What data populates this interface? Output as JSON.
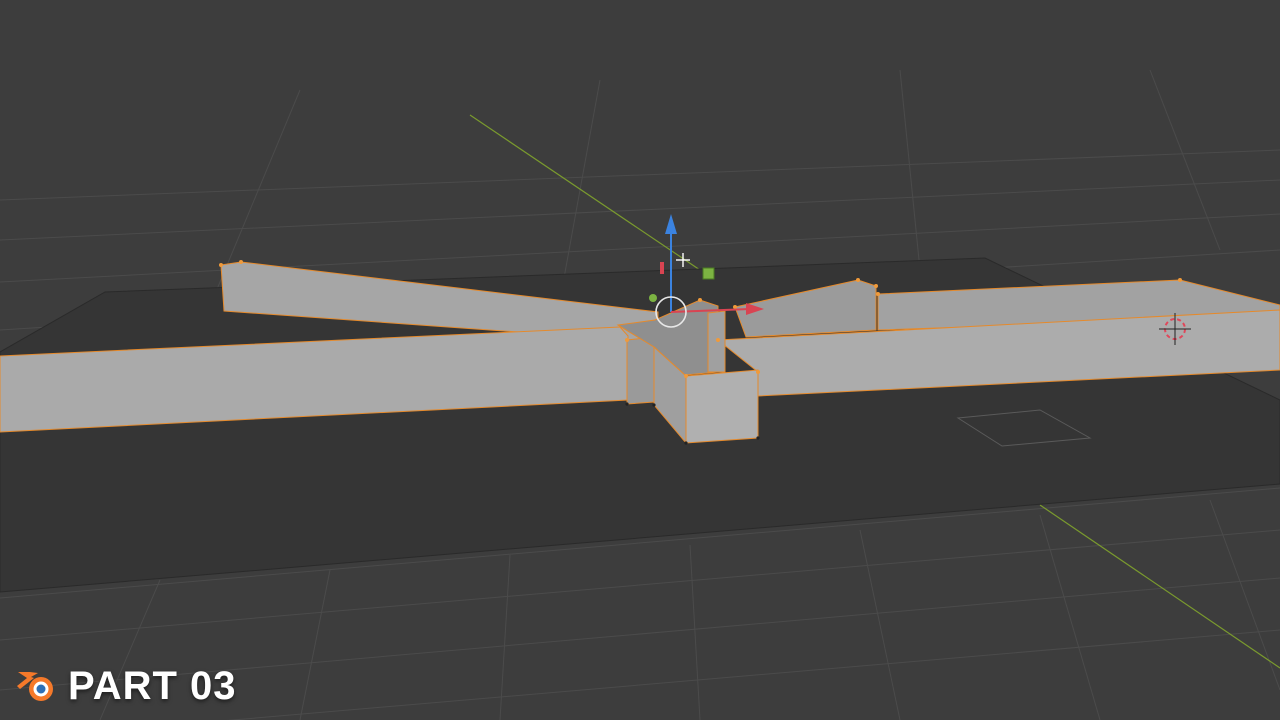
{
  "watermark": {
    "label": "PART 03",
    "logo_icon": "blender-logo-icon",
    "logo_color": "#f5792a"
  },
  "viewport": {
    "background_color": "#3d3d3d",
    "grid_color": "#4a4a4a",
    "plane_color": "#353535",
    "wall_color": "#a9a9a9",
    "wall_shade_color": "#8e8e8e",
    "selection_edge_color": "#e58a2c",
    "x_axis_color": "#d94452",
    "y_axis_color": "#7a9a2e",
    "z_axis_color": "#3b83e0",
    "gizmo_icons": [
      "move-gizmo-z-arrow-icon",
      "move-gizmo-x-arrow-icon",
      "move-gizmo-plane-handle-icon",
      "pivot-circle-icon",
      "3d-cursor-icon",
      "mouse-cursor-icon"
    ]
  }
}
